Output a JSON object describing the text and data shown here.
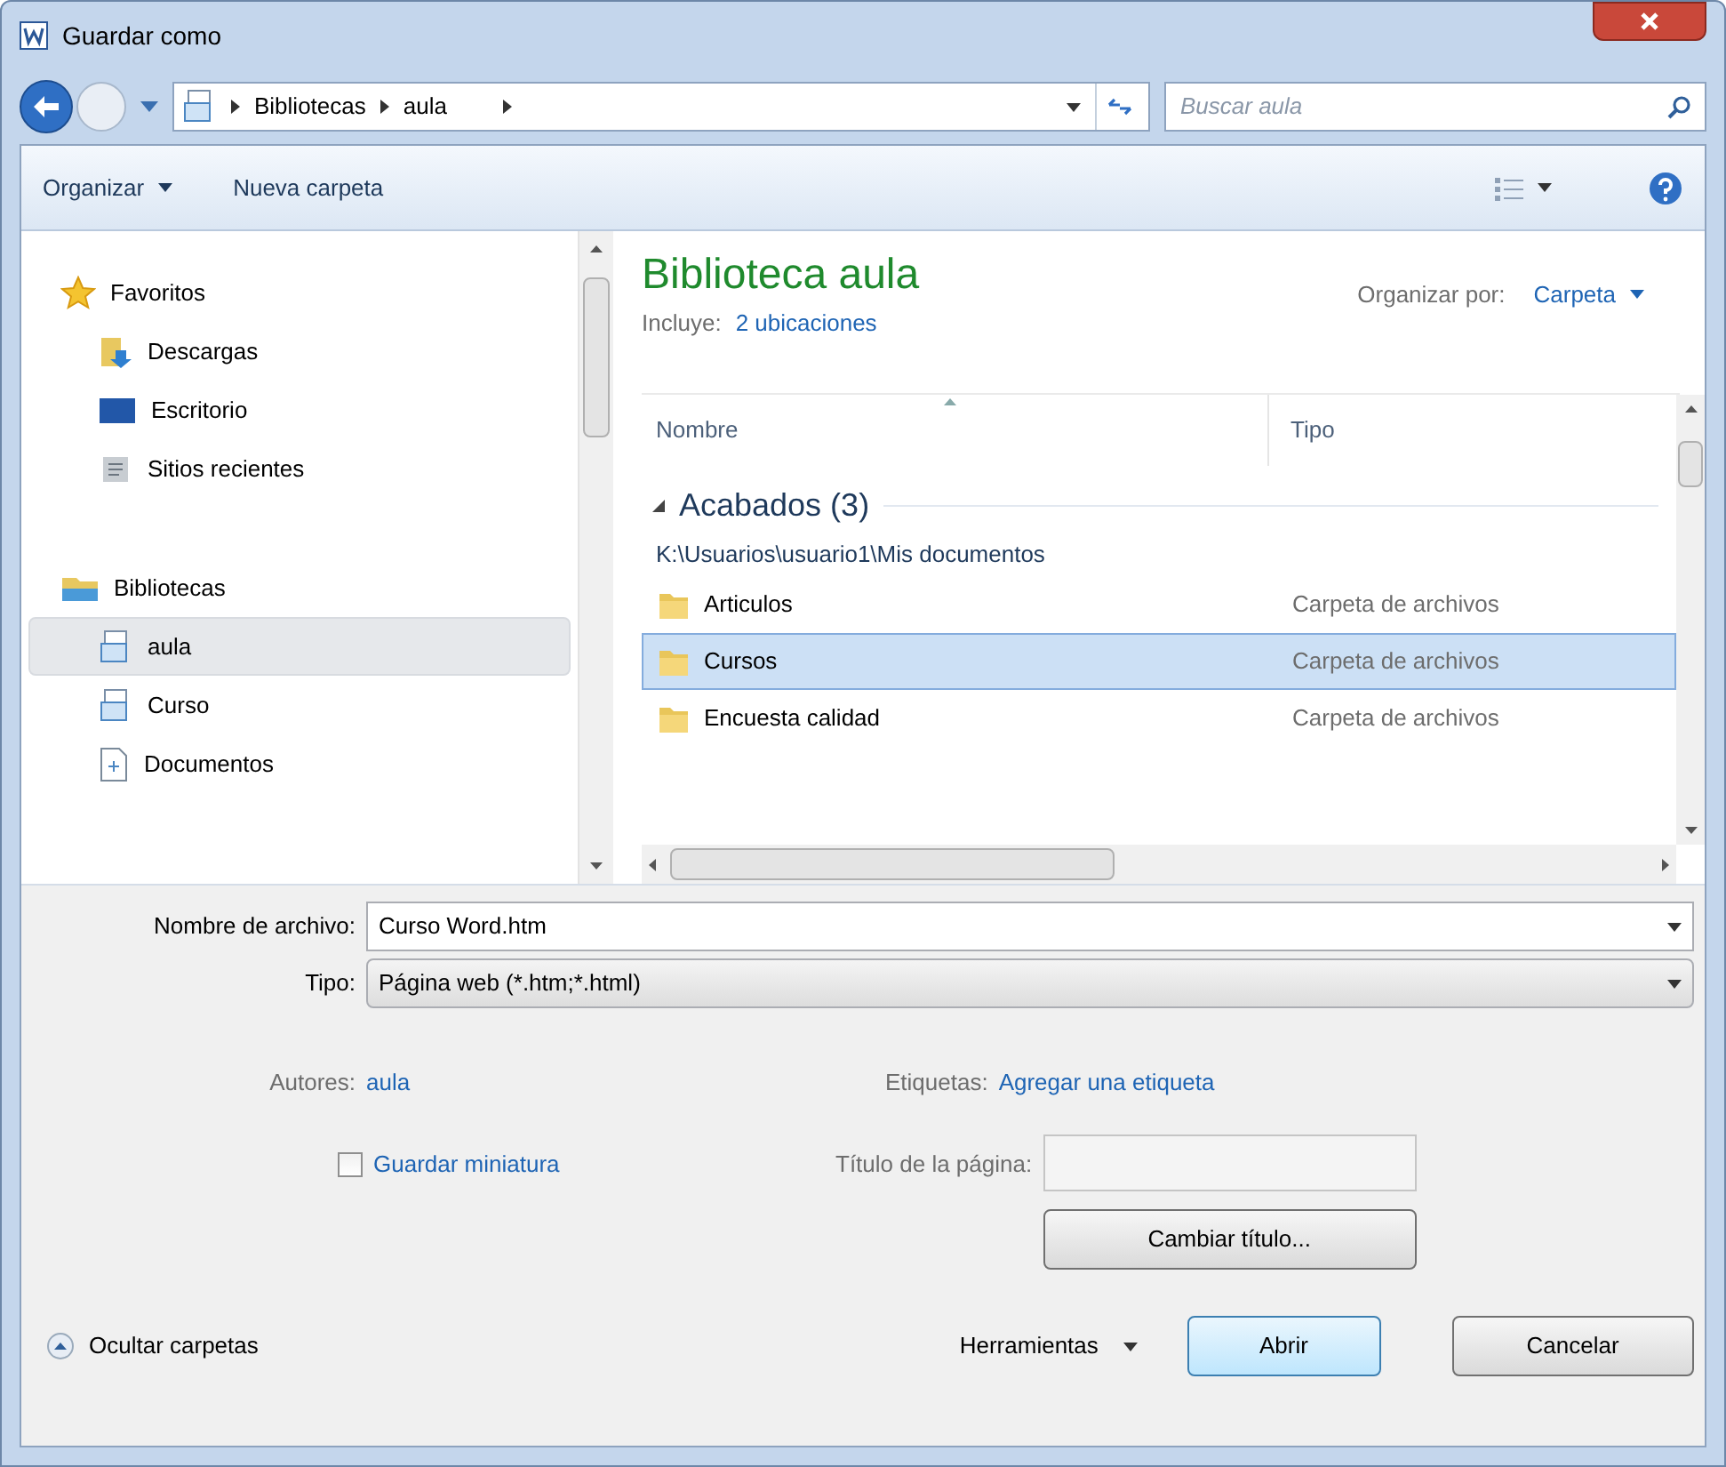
{
  "window": {
    "title": "Guardar como"
  },
  "address": {
    "crumbs": [
      "Bibliotecas",
      "aula"
    ],
    "search_placeholder": "Buscar aula"
  },
  "toolbar": [
    {
      "label": "Organizar",
      "has_menu": true
    },
    {
      "label": "Nueva carpeta",
      "has_menu": false
    }
  ],
  "sidebar": [
    {
      "label": "Favoritos",
      "kind": "star",
      "children": [
        {
          "label": "Descargas",
          "kind": "download",
          "selected": false
        },
        {
          "label": "Escritorio",
          "kind": "desktop",
          "selected": false
        },
        {
          "label": "Sitios recientes",
          "kind": "recent",
          "selected": false
        }
      ]
    },
    {
      "label": "Bibliotecas",
      "kind": "library",
      "children": [
        {
          "label": "aula",
          "kind": "doclib",
          "selected": true
        },
        {
          "label": "Curso",
          "kind": "doclib",
          "selected": false
        },
        {
          "label": "Documentos",
          "kind": "document",
          "selected": false
        }
      ]
    }
  ],
  "library": {
    "title": "Biblioteca aula",
    "includes_label": "Incluye:",
    "includes_link": "2 ubicaciones",
    "arrange_label": "Organizar por:",
    "arrange_value": "Carpeta"
  },
  "columns": [
    "Nombre",
    "Tipo"
  ],
  "group": {
    "label": "Acabados (3)",
    "expanded": true,
    "path": "K:\\Usuarios\\usuario1\\Mis documentos",
    "rows": [
      {
        "name": "Articulos",
        "type": "Carpeta de archivos",
        "selected": false
      },
      {
        "name": "Cursos",
        "type": "Carpeta de archivos",
        "selected": true
      },
      {
        "name": "Encuesta calidad",
        "type": "Carpeta de archivos",
        "selected": false
      }
    ]
  },
  "form": {
    "filename_label": "Nombre de archivo:",
    "filename": "Curso Word.htm",
    "type_label": "Tipo:",
    "type": "Página web (*.htm;*.html)",
    "authors_label": "Autores:",
    "authors": "aula",
    "tags_label": "Etiquetas:",
    "tags": "Agregar una etiqueta",
    "thumbnail": {
      "label": "Guardar miniatura",
      "checked": false
    },
    "page_title_label": "Título de la página:",
    "change_title": "Cambiar título..."
  },
  "footer": {
    "hide_folders": "Ocultar carpetas",
    "tools": "Herramientas",
    "buttons": [
      "Abrir",
      "Cancelar"
    ]
  }
}
